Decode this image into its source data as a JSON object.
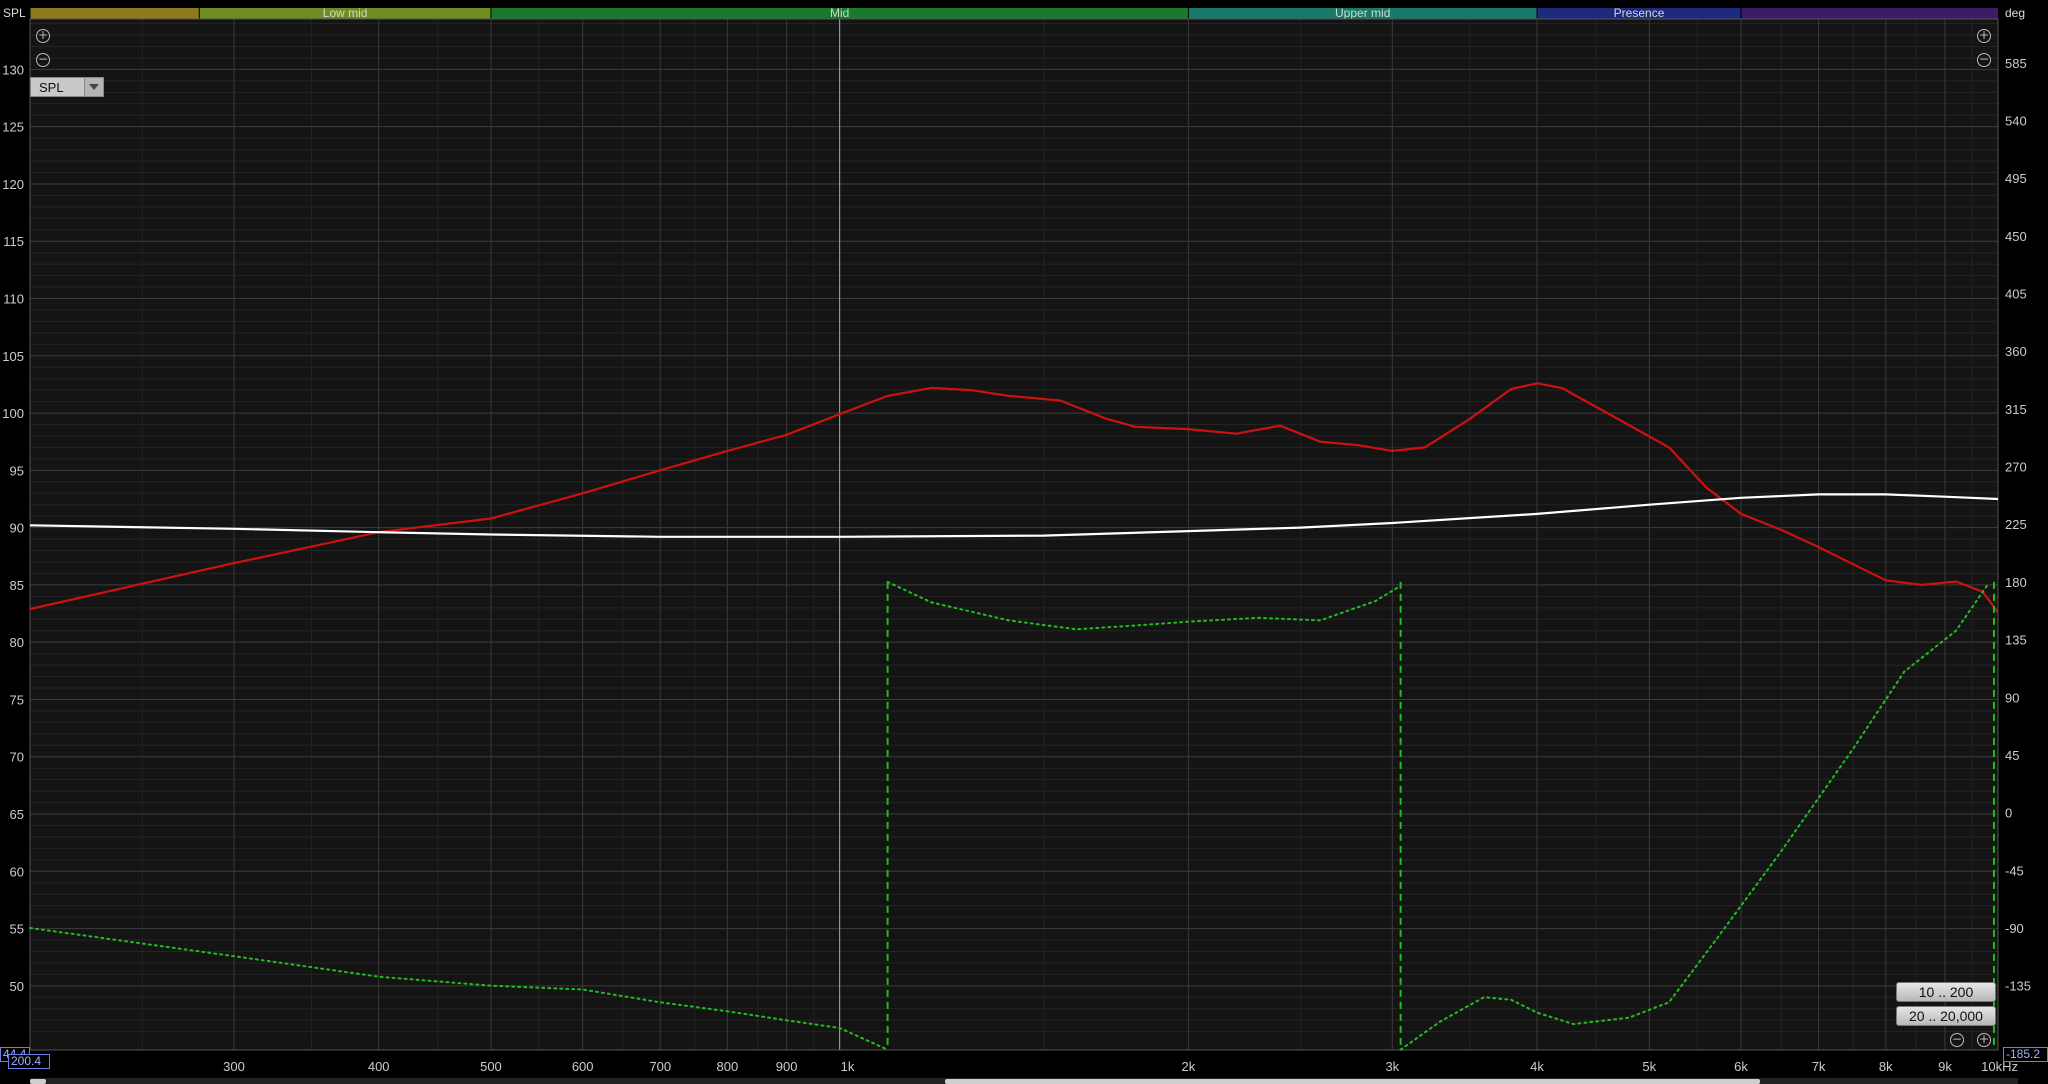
{
  "chart_data": {
    "type": "line",
    "left_axis_label": "SPL",
    "right_axis_label": "deg",
    "x_scale": "log",
    "x_range_hz": [
      200,
      10000
    ],
    "x_ticks": [
      {
        "v": 300,
        "label": "300"
      },
      {
        "v": 400,
        "label": "400"
      },
      {
        "v": 500,
        "label": "500"
      },
      {
        "v": 600,
        "label": "600"
      },
      {
        "v": 700,
        "label": "700"
      },
      {
        "v": 800,
        "label": "800"
      },
      {
        "v": 900,
        "label": "900"
      },
      {
        "v": 1000,
        "label": "1k"
      },
      {
        "v": 2000,
        "label": "2k"
      },
      {
        "v": 3000,
        "label": "3k"
      },
      {
        "v": 4000,
        "label": "4k"
      },
      {
        "v": 5000,
        "label": "5k"
      },
      {
        "v": 6000,
        "label": "6k"
      },
      {
        "v": 7000,
        "label": "7k"
      },
      {
        "v": 8000,
        "label": "8k"
      },
      {
        "v": 9000,
        "label": "9k"
      },
      {
        "v": 10000,
        "label": "10kHz"
      }
    ],
    "y_left_range": [
      44.4,
      134.4
    ],
    "y_left_ticks": [
      130,
      125,
      120,
      115,
      110,
      105,
      100,
      95,
      90,
      85,
      80,
      75,
      70,
      65,
      60,
      55,
      50
    ],
    "y_right_range": [
      -185.2,
      619.2
    ],
    "y_right_ticks": [
      585,
      540,
      495,
      450,
      405,
      360,
      315,
      270,
      225,
      180,
      135,
      90,
      45,
      0,
      -45,
      -90,
      -135
    ],
    "y_left_min_label": "44.4",
    "y_right_min_label": "-185.2",
    "x_min_label": "200.4",
    "bands": [
      {
        "label": "",
        "from": 200,
        "to": 280,
        "color": "#8f7a1e"
      },
      {
        "label": "Low mid",
        "from": 280,
        "to": 500,
        "color": "#6f8c20"
      },
      {
        "label": "Mid",
        "from": 500,
        "to": 2000,
        "color": "#197a2c"
      },
      {
        "label": "Upper mid",
        "from": 2000,
        "to": 4000,
        "color": "#177968"
      },
      {
        "label": "Presence",
        "from": 4000,
        "to": 6000,
        "color": "#1d2a7e"
      },
      {
        "label": "",
        "from": 6000,
        "to": 10000,
        "color": "#3c1c63"
      }
    ],
    "series": [
      {
        "name": "",
        "axis": "left",
        "color": "#cc1111",
        "style": "solid",
        "points": [
          [
            200,
            82.9
          ],
          [
            300,
            86.9
          ],
          [
            400,
            89.6
          ],
          [
            500,
            90.8
          ],
          [
            600,
            93.0
          ],
          [
            700,
            95.0
          ],
          [
            800,
            96.7
          ],
          [
            900,
            98.1
          ],
          [
            1000,
            99.9
          ],
          [
            1100,
            101.5
          ],
          [
            1200,
            102.2
          ],
          [
            1300,
            102.0
          ],
          [
            1400,
            101.5
          ],
          [
            1550,
            101.1
          ],
          [
            1700,
            99.5
          ],
          [
            1800,
            98.8
          ],
          [
            2000,
            98.6
          ],
          [
            2200,
            98.2
          ],
          [
            2400,
            98.9
          ],
          [
            2600,
            97.5
          ],
          [
            2800,
            97.2
          ],
          [
            3000,
            96.7
          ],
          [
            3200,
            97.0
          ],
          [
            3500,
            99.5
          ],
          [
            3800,
            102.1
          ],
          [
            4000,
            102.6
          ],
          [
            4200,
            102.2
          ],
          [
            4600,
            100.0
          ],
          [
            5200,
            97.0
          ],
          [
            5600,
            93.5
          ],
          [
            6000,
            91.2
          ],
          [
            6500,
            89.8
          ],
          [
            7000,
            88.3
          ],
          [
            7500,
            86.8
          ],
          [
            8000,
            85.4
          ],
          [
            8600,
            85.0
          ],
          [
            9200,
            85.3
          ],
          [
            9700,
            84.4
          ],
          [
            10000,
            82.6
          ]
        ]
      },
      {
        "name": "",
        "axis": "left",
        "color": "#ffffff",
        "style": "solid",
        "points": [
          [
            200,
            90.2
          ],
          [
            300,
            89.9
          ],
          [
            400,
            89.6
          ],
          [
            500,
            89.4
          ],
          [
            700,
            89.2
          ],
          [
            1000,
            89.2
          ],
          [
            1500,
            89.3
          ],
          [
            2000,
            89.7
          ],
          [
            2500,
            90.0
          ],
          [
            3000,
            90.4
          ],
          [
            4000,
            91.2
          ],
          [
            5000,
            92.0
          ],
          [
            6000,
            92.6
          ],
          [
            7000,
            92.9
          ],
          [
            8000,
            92.9
          ],
          [
            9000,
            92.7
          ],
          [
            10000,
            92.5
          ]
        ]
      },
      {
        "name": "",
        "axis": "right",
        "color": "#22bb22",
        "style": "dotted",
        "segments": [
          [
            [
              200,
              -90
            ],
            [
              300,
              -112
            ],
            [
              400,
              -128
            ],
            [
              500,
              -135
            ],
            [
              600,
              -138
            ],
            [
              700,
              -148
            ],
            [
              800,
              -155
            ],
            [
              900,
              -162
            ],
            [
              1000,
              -168
            ],
            [
              1100,
              -185
            ]
          ],
          [
            [
              1100,
              180
            ],
            [
              1200,
              164
            ],
            [
              1400,
              150
            ],
            [
              1600,
              143
            ],
            [
              1800,
              146
            ],
            [
              2000,
              149
            ],
            [
              2300,
              152
            ],
            [
              2600,
              150
            ],
            [
              2900,
              165
            ],
            [
              3050,
              177
            ]
          ],
          [
            [
              3050,
              -185
            ],
            [
              3300,
              -163
            ],
            [
              3600,
              -144
            ],
            [
              3800,
              -146
            ],
            [
              4000,
              -156
            ],
            [
              4300,
              -165
            ],
            [
              4800,
              -160
            ],
            [
              5200,
              -148
            ],
            [
              5700,
              -100
            ],
            [
              6500,
              -30
            ],
            [
              7500,
              50
            ],
            [
              8300,
              110
            ],
            [
              9200,
              142
            ],
            [
              9800,
              178
            ]
          ]
        ],
        "jumps": [
          1100,
          3050,
          9920
        ]
      }
    ]
  },
  "controls": {
    "spl_select": "SPL",
    "range_buttons": [
      "10 .. 200",
      "20 .. 20,000"
    ]
  }
}
